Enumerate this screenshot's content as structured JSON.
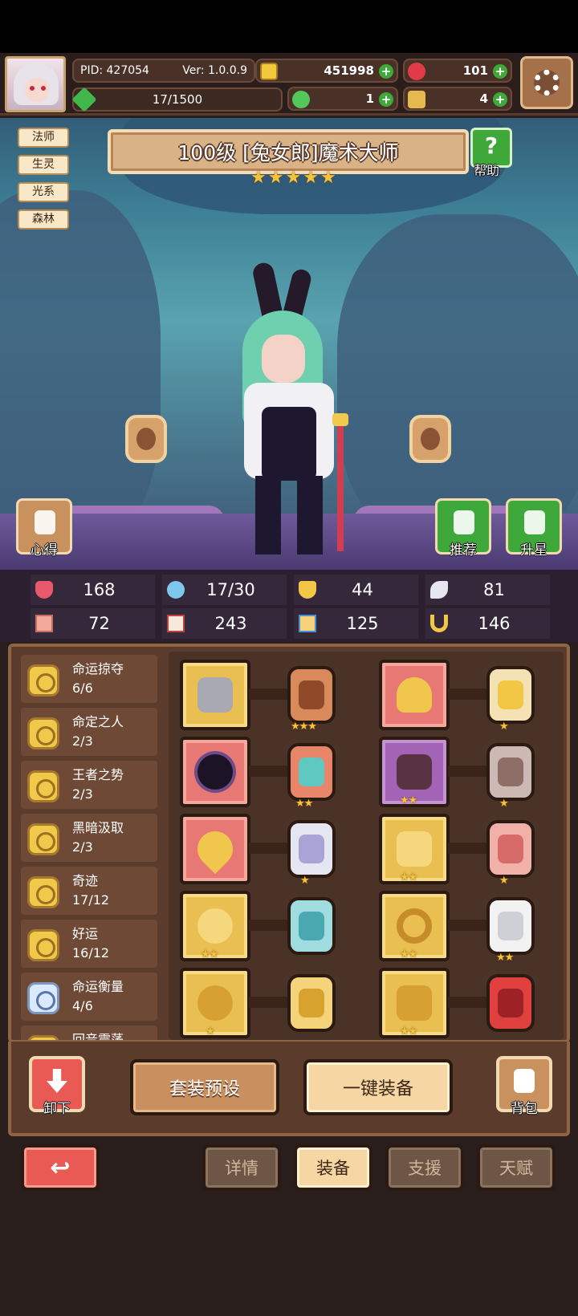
{
  "hud": {
    "pid": "PID: 427054",
    "version": "Ver: 1.0.0.9",
    "xp": "17/1500",
    "gold": "451998",
    "gems": "101",
    "clover": "1",
    "ticket": "4"
  },
  "hero": {
    "tags": [
      "法师",
      "生灵",
      "光系",
      "森林"
    ],
    "title": "100级 [兔女郎]魔术大师",
    "stars": 5,
    "help_label": "帮助",
    "tips_label": "心得",
    "recommend_label": "推荐",
    "star_up_label": "升星"
  },
  "stats": [
    {
      "icon": "heart-icon",
      "value": "168"
    },
    {
      "icon": "mana-drop-icon",
      "value": "17/30"
    },
    {
      "icon": "shield-icon",
      "value": "44"
    },
    {
      "icon": "wing-icon",
      "value": "81"
    },
    {
      "icon": "fist-icon",
      "value": "72"
    },
    {
      "icon": "book-icon",
      "value": "243"
    },
    {
      "icon": "scroll-icon",
      "value": "125"
    },
    {
      "icon": "horseshoe-icon",
      "value": "146"
    }
  ],
  "sets": [
    {
      "name": "命运掠夺",
      "count": "6/6",
      "icon": "gold-coin-icon"
    },
    {
      "name": "命定之人",
      "count": "2/3",
      "icon": "gold-coin-icon"
    },
    {
      "name": "王者之势",
      "count": "2/3",
      "icon": "crown-coin-icon"
    },
    {
      "name": "黑暗汲取",
      "count": "2/3",
      "icon": "gold-coin-icon"
    },
    {
      "name": "奇迹",
      "count": "17/12",
      "icon": "gold-coin-icon"
    },
    {
      "name": "好运",
      "count": "16/12",
      "icon": "shield-coin-icon"
    },
    {
      "name": "命运衡量",
      "count": "4/6",
      "icon": "silver-coin-icon"
    },
    {
      "name": "回音震荡",
      "count": "",
      "icon": "gold-coin-icon"
    }
  ],
  "equipment": [
    {
      "slot": "weapon",
      "item": "axe-icon",
      "color": "gold",
      "gem_stars": "★★★",
      "item_stars": ""
    },
    {
      "slot": "hat",
      "item": "straw-hat-icon",
      "color": "red",
      "gem_stars": "★",
      "item_stars": ""
    },
    {
      "slot": "orb",
      "item": "dark-orb-icon",
      "color": "red",
      "gem_stars": "★★",
      "item_stars": ""
    },
    {
      "slot": "cape",
      "item": "cape-icon",
      "color": "purple",
      "gem_stars": "★",
      "item_stars": "★★"
    },
    {
      "slot": "necklace",
      "item": "necklace-icon",
      "color": "red",
      "gem_stars": "★",
      "item_stars": ""
    },
    {
      "slot": "bone",
      "item": "bone-icon",
      "color": "gold",
      "gem_stars": "★",
      "item_stars": "★★"
    },
    {
      "slot": "amulet",
      "item": "amulet-icon",
      "color": "gold",
      "gem_stars": "",
      "item_stars": "★★"
    },
    {
      "slot": "ring",
      "item": "ring-icon",
      "color": "gold",
      "gem_stars": "★★",
      "item_stars": "★★"
    },
    {
      "slot": "pendant",
      "item": "pendant-icon",
      "color": "gold",
      "gem_stars": "",
      "item_stars": "★"
    },
    {
      "slot": "boots",
      "item": "boots-icon",
      "color": "gold",
      "gem_stars": "",
      "item_stars": "★★"
    }
  ],
  "actions": {
    "unequip": "卸下",
    "preset": "套装预设",
    "auto_equip": "一键装备",
    "bag": "背包"
  },
  "nav": {
    "back": "↩",
    "tabs": [
      "详情",
      "装备",
      "支援",
      "天赋"
    ],
    "active_tab": "装备"
  },
  "colors": {
    "panel": "#5b3c2c",
    "gold_slot": "#e9bf52",
    "red_slot": "#e77874",
    "green_button": "#3fa83a"
  }
}
